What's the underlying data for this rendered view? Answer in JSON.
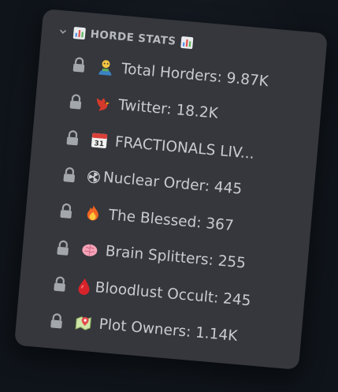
{
  "category": {
    "name": "HORDE STATS"
  },
  "channels": [
    {
      "emoji": "person-icon",
      "text": "Total Horders: 9.87K"
    },
    {
      "emoji": "cardinal-bird-icon",
      "text": "Twitter: 18.2K"
    },
    {
      "emoji": "calendar-icon",
      "text": "FRACTIONALS LIV..."
    },
    {
      "emoji": "radioactive-icon",
      "text": "Nuclear Order: 445"
    },
    {
      "emoji": "fire-icon",
      "text": "The Blessed: 367"
    },
    {
      "emoji": "brain-icon",
      "text": "Brain Splitters: 255"
    },
    {
      "emoji": "blood-drop-icon",
      "text": "Bloodlust Occult: 245"
    },
    {
      "emoji": "map-pin-icon",
      "text": "Plot Owners: 1.14K"
    }
  ],
  "colors": {
    "panel": "#35373c",
    "text": "#c9cbcf",
    "category_text": "#b6b9bf",
    "background": "#11161d"
  }
}
